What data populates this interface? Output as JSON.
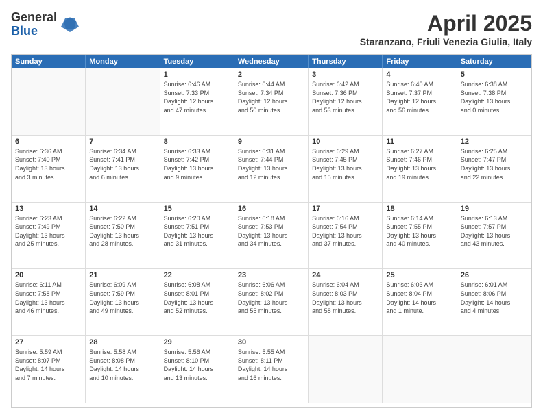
{
  "logo": {
    "general": "General",
    "blue": "Blue"
  },
  "title": "April 2025",
  "location": "Staranzano, Friuli Venezia Giulia, Italy",
  "days_of_week": [
    "Sunday",
    "Monday",
    "Tuesday",
    "Wednesday",
    "Thursday",
    "Friday",
    "Saturday"
  ],
  "weeks": [
    [
      {
        "day": "",
        "info": ""
      },
      {
        "day": "",
        "info": ""
      },
      {
        "day": "1",
        "info": "Sunrise: 6:46 AM\nSunset: 7:33 PM\nDaylight: 12 hours\nand 47 minutes."
      },
      {
        "day": "2",
        "info": "Sunrise: 6:44 AM\nSunset: 7:34 PM\nDaylight: 12 hours\nand 50 minutes."
      },
      {
        "day": "3",
        "info": "Sunrise: 6:42 AM\nSunset: 7:36 PM\nDaylight: 12 hours\nand 53 minutes."
      },
      {
        "day": "4",
        "info": "Sunrise: 6:40 AM\nSunset: 7:37 PM\nDaylight: 12 hours\nand 56 minutes."
      },
      {
        "day": "5",
        "info": "Sunrise: 6:38 AM\nSunset: 7:38 PM\nDaylight: 13 hours\nand 0 minutes."
      }
    ],
    [
      {
        "day": "6",
        "info": "Sunrise: 6:36 AM\nSunset: 7:40 PM\nDaylight: 13 hours\nand 3 minutes."
      },
      {
        "day": "7",
        "info": "Sunrise: 6:34 AM\nSunset: 7:41 PM\nDaylight: 13 hours\nand 6 minutes."
      },
      {
        "day": "8",
        "info": "Sunrise: 6:33 AM\nSunset: 7:42 PM\nDaylight: 13 hours\nand 9 minutes."
      },
      {
        "day": "9",
        "info": "Sunrise: 6:31 AM\nSunset: 7:44 PM\nDaylight: 13 hours\nand 12 minutes."
      },
      {
        "day": "10",
        "info": "Sunrise: 6:29 AM\nSunset: 7:45 PM\nDaylight: 13 hours\nand 15 minutes."
      },
      {
        "day": "11",
        "info": "Sunrise: 6:27 AM\nSunset: 7:46 PM\nDaylight: 13 hours\nand 19 minutes."
      },
      {
        "day": "12",
        "info": "Sunrise: 6:25 AM\nSunset: 7:47 PM\nDaylight: 13 hours\nand 22 minutes."
      }
    ],
    [
      {
        "day": "13",
        "info": "Sunrise: 6:23 AM\nSunset: 7:49 PM\nDaylight: 13 hours\nand 25 minutes."
      },
      {
        "day": "14",
        "info": "Sunrise: 6:22 AM\nSunset: 7:50 PM\nDaylight: 13 hours\nand 28 minutes."
      },
      {
        "day": "15",
        "info": "Sunrise: 6:20 AM\nSunset: 7:51 PM\nDaylight: 13 hours\nand 31 minutes."
      },
      {
        "day": "16",
        "info": "Sunrise: 6:18 AM\nSunset: 7:53 PM\nDaylight: 13 hours\nand 34 minutes."
      },
      {
        "day": "17",
        "info": "Sunrise: 6:16 AM\nSunset: 7:54 PM\nDaylight: 13 hours\nand 37 minutes."
      },
      {
        "day": "18",
        "info": "Sunrise: 6:14 AM\nSunset: 7:55 PM\nDaylight: 13 hours\nand 40 minutes."
      },
      {
        "day": "19",
        "info": "Sunrise: 6:13 AM\nSunset: 7:57 PM\nDaylight: 13 hours\nand 43 minutes."
      }
    ],
    [
      {
        "day": "20",
        "info": "Sunrise: 6:11 AM\nSunset: 7:58 PM\nDaylight: 13 hours\nand 46 minutes."
      },
      {
        "day": "21",
        "info": "Sunrise: 6:09 AM\nSunset: 7:59 PM\nDaylight: 13 hours\nand 49 minutes."
      },
      {
        "day": "22",
        "info": "Sunrise: 6:08 AM\nSunset: 8:01 PM\nDaylight: 13 hours\nand 52 minutes."
      },
      {
        "day": "23",
        "info": "Sunrise: 6:06 AM\nSunset: 8:02 PM\nDaylight: 13 hours\nand 55 minutes."
      },
      {
        "day": "24",
        "info": "Sunrise: 6:04 AM\nSunset: 8:03 PM\nDaylight: 13 hours\nand 58 minutes."
      },
      {
        "day": "25",
        "info": "Sunrise: 6:03 AM\nSunset: 8:04 PM\nDaylight: 14 hours\nand 1 minute."
      },
      {
        "day": "26",
        "info": "Sunrise: 6:01 AM\nSunset: 8:06 PM\nDaylight: 14 hours\nand 4 minutes."
      }
    ],
    [
      {
        "day": "27",
        "info": "Sunrise: 5:59 AM\nSunset: 8:07 PM\nDaylight: 14 hours\nand 7 minutes."
      },
      {
        "day": "28",
        "info": "Sunrise: 5:58 AM\nSunset: 8:08 PM\nDaylight: 14 hours\nand 10 minutes."
      },
      {
        "day": "29",
        "info": "Sunrise: 5:56 AM\nSunset: 8:10 PM\nDaylight: 14 hours\nand 13 minutes."
      },
      {
        "day": "30",
        "info": "Sunrise: 5:55 AM\nSunset: 8:11 PM\nDaylight: 14 hours\nand 16 minutes."
      },
      {
        "day": "",
        "info": ""
      },
      {
        "day": "",
        "info": ""
      },
      {
        "day": "",
        "info": ""
      }
    ]
  ]
}
